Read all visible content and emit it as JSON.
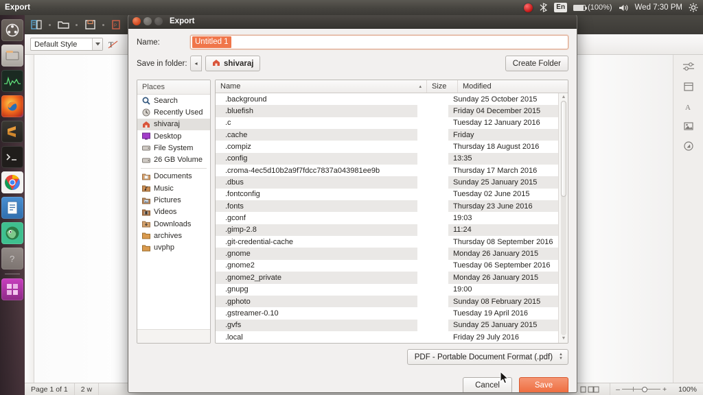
{
  "panel": {
    "app_name": "Export",
    "indicators": {
      "record_icon": "record-red-icon",
      "bluetooth_icon": "bluetooth-icon",
      "keyboard_layout": "En",
      "battery_icon": "battery-icon",
      "battery_label": "(100%)",
      "volume_icon": "volume-icon",
      "clock": "Wed 7:30 PM",
      "gear_icon": "gear-icon"
    }
  },
  "launcher": {
    "items": [
      {
        "name": "ubuntu-dash-icon",
        "label": "Dash"
      },
      {
        "name": "files-icon",
        "label": "Files"
      },
      {
        "name": "system-monitor-icon",
        "label": "System Monitor"
      },
      {
        "name": "firefox-icon",
        "label": "Firefox"
      },
      {
        "name": "sublime-text-icon",
        "label": "Sublime Text"
      },
      {
        "name": "terminal-icon",
        "label": "Terminal"
      },
      {
        "name": "chrome-icon",
        "label": "Google Chrome"
      },
      {
        "name": "libreoffice-writer-icon",
        "label": "LibreOffice Writer"
      },
      {
        "name": "gimp-icon",
        "label": "GIMP"
      },
      {
        "name": "help-icon",
        "label": "Help"
      },
      {
        "name": "workspace-switcher-icon",
        "label": "Workspace Switcher"
      }
    ]
  },
  "libreoffice": {
    "style_box_value": "Default Style",
    "status": {
      "page": "Page 1 of 1",
      "words": "2 w",
      "zoom": "100%"
    }
  },
  "dialog": {
    "title": "Export",
    "name_label": "Name:",
    "name_value": "Untitled 1",
    "folder_label": "Save in folder:",
    "back_arrow": "◂",
    "current_folder": "shivaraj",
    "create_folder_label": "Create Folder",
    "places": {
      "header": "Places",
      "items": [
        {
          "label": "Search",
          "icon": "search-icon",
          "active": false
        },
        {
          "label": "Recently Used",
          "icon": "recent-icon",
          "active": false
        },
        {
          "label": "shivaraj",
          "icon": "home-folder-icon",
          "active": true
        },
        {
          "label": "Desktop",
          "icon": "desktop-icon",
          "active": false
        },
        {
          "label": "File System",
          "icon": "drive-icon",
          "active": false
        },
        {
          "label": "26 GB Volume",
          "icon": "drive-icon",
          "active": false
        },
        {
          "label": "Documents",
          "icon": "documents-folder-icon",
          "active": false
        },
        {
          "label": "Music",
          "icon": "music-folder-icon",
          "active": false
        },
        {
          "label": "Pictures",
          "icon": "pictures-folder-icon",
          "active": false
        },
        {
          "label": "Videos",
          "icon": "videos-folder-icon",
          "active": false
        },
        {
          "label": "Downloads",
          "icon": "downloads-folder-icon",
          "active": false
        },
        {
          "label": "archives",
          "icon": "folder-icon",
          "active": false
        },
        {
          "label": "uvphp",
          "icon": "folder-icon",
          "active": false
        }
      ]
    },
    "filelist": {
      "columns": {
        "name": "Name",
        "size": "Size",
        "modified": "Modified"
      },
      "sort_column": "Name",
      "sort_arrow": "▴",
      "rows": [
        {
          "name": ".background",
          "size": "",
          "modified": "Sunday 25 October 2015"
        },
        {
          "name": ".bluefish",
          "size": "",
          "modified": "Friday 04 December 2015"
        },
        {
          "name": ".c",
          "size": "",
          "modified": "Tuesday 12 January 2016"
        },
        {
          "name": ".cache",
          "size": "",
          "modified": "Friday"
        },
        {
          "name": ".compiz",
          "size": "",
          "modified": "Thursday 18 August 2016"
        },
        {
          "name": ".config",
          "size": "",
          "modified": "13:35"
        },
        {
          "name": ".croma-4ec5d10b2a9f7fdcc7837a043981ee9b",
          "size": "",
          "modified": "Thursday 17 March 2016"
        },
        {
          "name": ".dbus",
          "size": "",
          "modified": "Sunday 25 January 2015"
        },
        {
          "name": ".fontconfig",
          "size": "",
          "modified": "Tuesday 02 June 2015"
        },
        {
          "name": ".fonts",
          "size": "",
          "modified": "Thursday 23 June 2016"
        },
        {
          "name": ".gconf",
          "size": "",
          "modified": "19:03"
        },
        {
          "name": ".gimp-2.8",
          "size": "",
          "modified": "11:24"
        },
        {
          "name": ".git-credential-cache",
          "size": "",
          "modified": "Thursday 08 September 2016"
        },
        {
          "name": ".gnome",
          "size": "",
          "modified": "Monday 26 January 2015"
        },
        {
          "name": ".gnome2",
          "size": "",
          "modified": "Tuesday 06 September 2016"
        },
        {
          "name": ".gnome2_private",
          "size": "",
          "modified": "Monday 26 January 2015"
        },
        {
          "name": ".gnupg",
          "size": "",
          "modified": "19:00"
        },
        {
          "name": ".gphoto",
          "size": "",
          "modified": "Sunday 08 February 2015"
        },
        {
          "name": ".gstreamer-0.10",
          "size": "",
          "modified": "Tuesday 19 April 2016"
        },
        {
          "name": ".gvfs",
          "size": "",
          "modified": "Sunday 25 January 2015"
        },
        {
          "name": ".local",
          "size": "",
          "modified": "Friday 29 July 2016"
        }
      ]
    },
    "file_format": "PDF - Portable Document Format (.pdf)",
    "cancel_label": "Cancel",
    "save_label": "Save"
  },
  "colors": {
    "accent_orange": "#ee6c3e",
    "selection_orange": "#f0764a",
    "titlebar_dark": "#403d39",
    "dialog_bg": "#f2f0ef"
  }
}
